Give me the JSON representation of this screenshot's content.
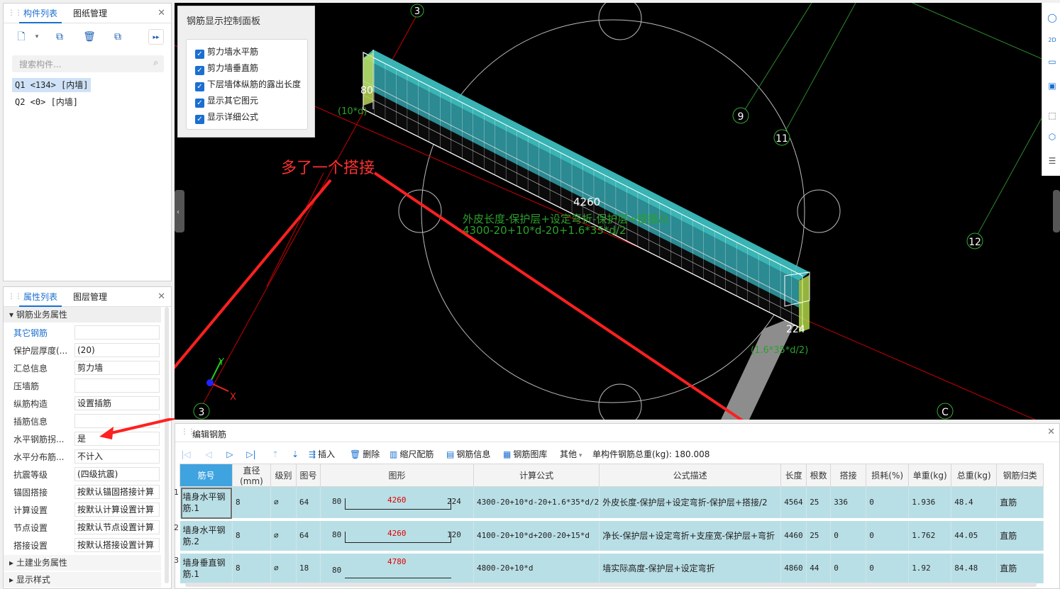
{
  "left_top": {
    "tabs": [
      "构件列表",
      "图纸管理"
    ],
    "search_placeholder": "搜索构件...",
    "components": [
      "Q1 <134> [内墙]",
      "Q2 <0> [内墙]"
    ]
  },
  "left_bottom": {
    "tabs": [
      "属性列表",
      "图层管理"
    ],
    "group_rebar": "钢筋业务属性",
    "props": [
      {
        "label": "其它钢筋",
        "value": ""
      },
      {
        "label": "保护层厚度(...",
        "value": "(20)"
      },
      {
        "label": "汇总信息",
        "value": "剪力墙"
      },
      {
        "label": "压墙筋",
        "value": ""
      },
      {
        "label": "纵筋构造",
        "value": "设置插筋"
      },
      {
        "label": "插筋信息",
        "value": ""
      },
      {
        "label": "水平钢筋拐...",
        "value": "是"
      },
      {
        "label": "水平分布筋...",
        "value": "不计入"
      },
      {
        "label": "抗震等级",
        "value": "(四级抗震)"
      },
      {
        "label": "锚固搭接",
        "value": "按默认锚固搭接计算"
      },
      {
        "label": "计算设置",
        "value": "按默认计算设置计算"
      },
      {
        "label": "节点设置",
        "value": "按默认节点设置计算"
      },
      {
        "label": "搭接设置",
        "value": "按默认搭接设置计算"
      }
    ],
    "group_civil": "土建业务属性",
    "group_display": "显示样式"
  },
  "control_panel": {
    "title": "钢筋显示控制面板",
    "options": [
      "剪力墙水平筋",
      "剪力墙垂直筋",
      "下层墙体纵筋的露出长度",
      "显示其它图元",
      "显示详细公式"
    ]
  },
  "viewport": {
    "axis_labels": [
      "3",
      "9",
      "11",
      "12",
      "3",
      "C"
    ],
    "dim_80": "80",
    "dim_10d": "(10*d)",
    "dim_4260": "4260",
    "dim_224": "224",
    "dim_lap": "(1.6*35*d/2)",
    "formula_desc": "外皮长度-保护层+设定弯折-保护层+搭接/2",
    "formula_calc": "4300-20+10*d-20+1.6*35*d/2",
    "annotation": "多了一个搭接",
    "axis_x": "X",
    "axis_y": "Y"
  },
  "bottom": {
    "title": "编辑钢筋",
    "toolbar": [
      "插入",
      "删除",
      "缩尺配筋",
      "钢筋信息",
      "钢筋图库",
      "其他"
    ],
    "total_weight": "单构件钢筋总重(kg): 180.008",
    "columns": [
      "筋号",
      "直径(mm)",
      "级别",
      "图号",
      "图形",
      "计算公式",
      "公式描述",
      "长度",
      "根数",
      "搭接",
      "损耗(%)",
      "单重(kg)",
      "总重(kg)",
      "钢筋归类"
    ],
    "rows": [
      {
        "no": "1",
        "name": "墙身水平钢筋.1",
        "dia": "8",
        "grade": "⌀",
        "fig": "64",
        "l": "80",
        "m": "4260",
        "r": "224",
        "formula": "4300-20+10*d-20+1.6*35*d/2",
        "desc": "外皮长度-保护层+设定弯折-保护层+搭接/2",
        "len": "4564",
        "count": "25",
        "lap": "336",
        "loss": "0",
        "unit": "1.936",
        "total": "48.4",
        "cls": "直筋"
      },
      {
        "no": "2",
        "name": "墙身水平钢筋.2",
        "dia": "8",
        "grade": "⌀",
        "fig": "64",
        "l": "80",
        "m": "4260",
        "r": "120",
        "formula": "4100-20+10*d+200-20+15*d",
        "desc": "净长-保护层+设定弯折+支座宽-保护层+弯折",
        "len": "4460",
        "count": "25",
        "lap": "0",
        "loss": "0",
        "unit": "1.762",
        "total": "44.05",
        "cls": "直筋"
      },
      {
        "no": "3",
        "name": "墙身垂直钢筋.1",
        "dia": "8",
        "grade": "⌀",
        "fig": "18",
        "l": "80",
        "m": "4780",
        "r": "",
        "formula": "4800-20+10*d",
        "desc": "墙实际高度-保护层+设定弯折",
        "len": "4860",
        "count": "44",
        "lap": "0",
        "loss": "0",
        "unit": "1.92",
        "total": "84.48",
        "cls": "直筋"
      }
    ]
  }
}
